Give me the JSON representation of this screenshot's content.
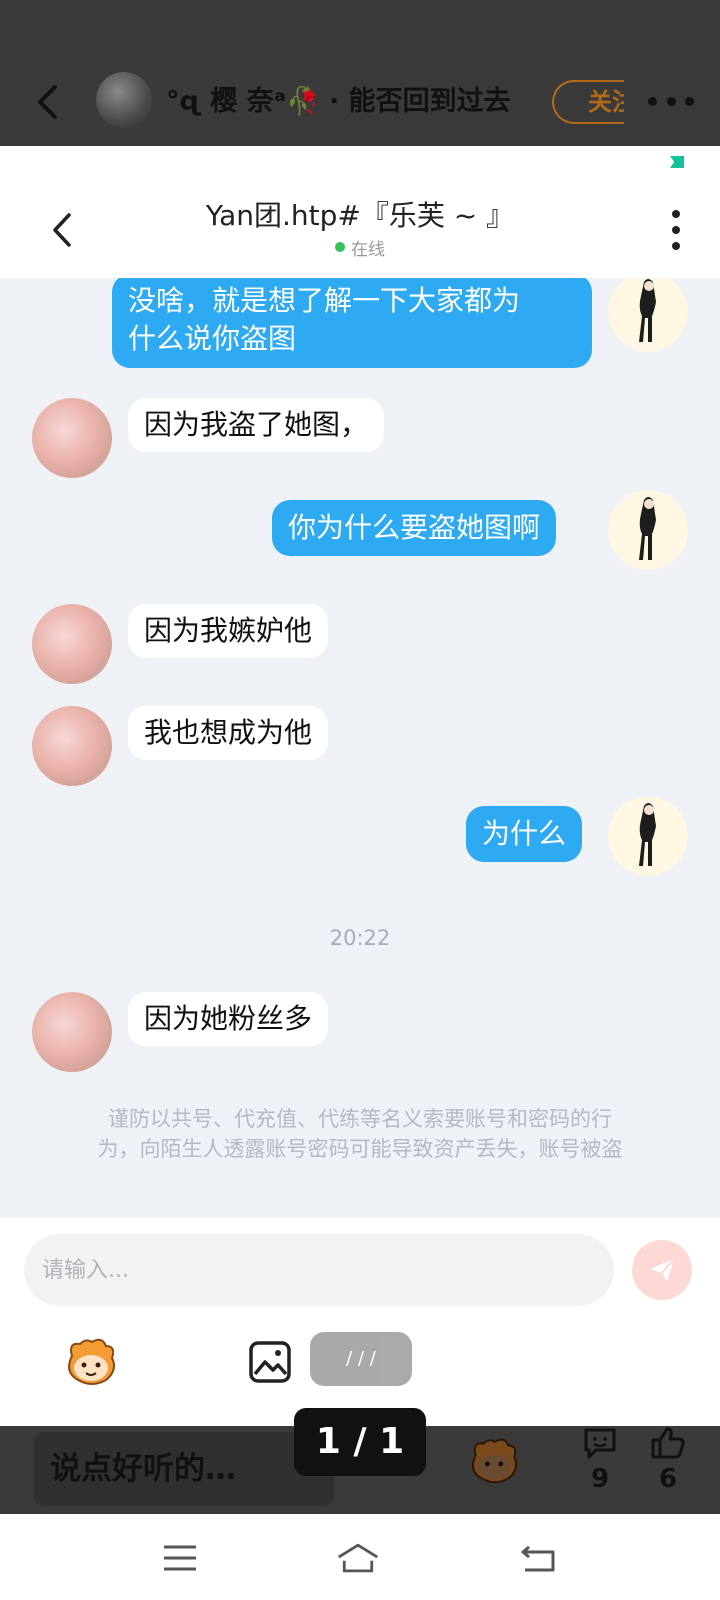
{
  "outer_header": {
    "title": "°ɋ 樱 奈ᵃ🥀 · 能否回到过去",
    "follow_label": "关注"
  },
  "chat_header": {
    "title": "Yan团.htp#『乐芙 ~ 』",
    "status": "在线"
  },
  "messages": [
    {
      "side": "out",
      "text": [
        "没啥，就是想了解一下大家都为",
        "什么说你盗图"
      ]
    },
    {
      "side": "in",
      "text": [
        "因为我盗了她图，"
      ]
    },
    {
      "side": "out",
      "text": [
        "你为什么要盗她图啊"
      ]
    },
    {
      "side": "in",
      "text": [
        "因为我嫉妒他"
      ]
    },
    {
      "side": "in",
      "text": [
        "我也想成为他"
      ]
    },
    {
      "side": "out",
      "text": [
        "为什么"
      ]
    },
    {
      "side": "in",
      "text": [
        "因为她粉丝多"
      ]
    }
  ],
  "time_separator": "20:22",
  "safety_notice": [
    "谨防以共号、代充值、代练等名义索要账号和密码的行",
    "为，向陌生人透露账号密码可能导致资产丢失，账号被盗"
  ],
  "input": {
    "placeholder": "请输入..."
  },
  "image_counter_small": "/ / /",
  "image_counter": "1 / 1",
  "comment_bar": {
    "placeholder": "说点好听的…",
    "comment_count": "9",
    "like_count": "6"
  },
  "icons": [
    "back-icon",
    "more-icon",
    "send-icon",
    "emoji-sticker-icon",
    "image-icon",
    "comment-icon",
    "like-icon",
    "menu-icon",
    "home-icon",
    "return-icon"
  ],
  "colors": {
    "outgoing_bubble": "#2eaaf2",
    "incoming_bubble": "#ffffff",
    "chat_background": "#eef2f7",
    "online_dot": "#35c25a",
    "follow_accent": "#b36b1a",
    "send_button": "#fcd9d4"
  }
}
